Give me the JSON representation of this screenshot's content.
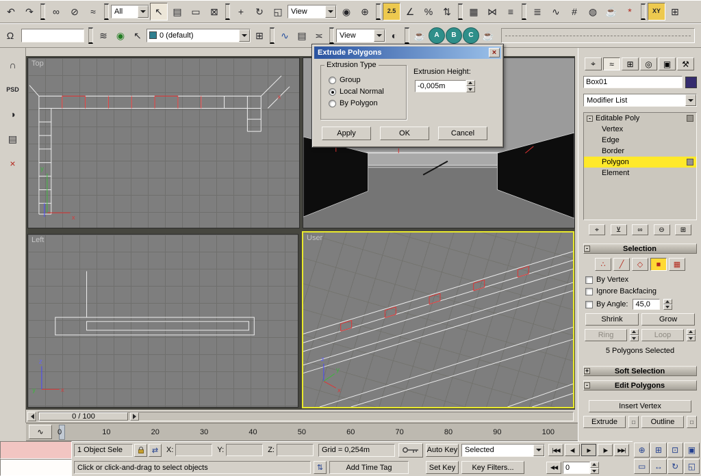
{
  "colors": {
    "object_color": "#352c6e",
    "layer_color": "#2f7f8f",
    "active_viewport_border": "#e9e92c",
    "stack_highlight": "#ffe92a"
  },
  "icons": {
    "close": "×",
    "mini_curve": "∿",
    "stack_collapse": "-",
    "settings_box": "□",
    "abs_offset": "⇄",
    "prompt": "⇅"
  },
  "toolbar1": {
    "selection_filter": "All",
    "ref_coord": "View",
    "group_a": [
      {
        "name": "undo-icon",
        "glyph": "↶"
      },
      {
        "name": "redo-icon",
        "glyph": "↷"
      },
      {
        "sep": true
      },
      {
        "name": "select-and-link-icon",
        "glyph": "∞"
      },
      {
        "name": "unlink-selection-icon",
        "glyph": "⊘"
      },
      {
        "name": "bind-to-space-warp-icon",
        "glyph": "≈"
      },
      {
        "sep": true
      }
    ],
    "group_b": [
      {
        "name": "select-object-icon",
        "glyph": "↖",
        "cls": "pressed"
      },
      {
        "name": "select-by-name-icon",
        "glyph": "▤"
      },
      {
        "name": "rect-selection-region-icon",
        "glyph": "▭"
      },
      {
        "name": "window-crossing-icon",
        "glyph": "⊠"
      },
      {
        "sep": true
      },
      {
        "name": "select-and-move-icon",
        "glyph": "+"
      },
      {
        "name": "select-and-rotate-icon",
        "glyph": "↻"
      },
      {
        "name": "select-and-scale-icon",
        "glyph": "◱"
      }
    ],
    "group_c": [
      {
        "name": "use-pivot-center-icon",
        "glyph": "◉"
      },
      {
        "name": "select-and-manipulate-icon",
        "glyph": "⊕"
      },
      {
        "sep": true
      },
      {
        "name": "snap-toggle-25-icon",
        "glyph": "2.5",
        "cls": "pressed warn small"
      },
      {
        "name": "angle-snap-icon",
        "glyph": "∠"
      },
      {
        "name": "percent-snap-icon",
        "glyph": "%"
      },
      {
        "name": "spinner-snap-icon",
        "glyph": "⇅"
      },
      {
        "sep": true
      },
      {
        "name": "edit-named-selections-icon",
        "glyph": "▦"
      },
      {
        "name": "mirror-icon",
        "glyph": "⋈"
      },
      {
        "name": "align-icon",
        "glyph": "≡"
      },
      {
        "sep": true
      },
      {
        "name": "layer-manager-icon",
        "glyph": "≣"
      },
      {
        "name": "curve-editor-icon",
        "glyph": "∿"
      },
      {
        "name": "schematic-view-icon",
        "glyph": "#"
      },
      {
        "name": "material-editor-icon",
        "glyph": "◍"
      },
      {
        "name": "render-setup-icon",
        "glyph": "☕"
      },
      {
        "name": "render-type-icon",
        "glyph": "*",
        "cls": "red"
      },
      {
        "sep": true
      },
      {
        "name": "axis-constraint-xy-icon",
        "glyph": "XY",
        "cls": "pressed warn small"
      },
      {
        "name": "snap-extra-icon",
        "glyph": "⊞"
      }
    ]
  },
  "toolbar2": {
    "layer": "0 (default)",
    "view": "View",
    "group_a": [
      {
        "name": "named-selection-sets-icon",
        "glyph": "Ω"
      }
    ],
    "group_b": [
      {
        "sep": true
      },
      {
        "name": "layer-list-icon",
        "glyph": "≋"
      },
      {
        "name": "layer-visibility-icon",
        "glyph": "◉",
        "cls": "green"
      },
      {
        "name": "select-objects-in-layer-icon",
        "glyph": "↖"
      }
    ],
    "group_c": [
      {
        "name": "create-new-layer-icon",
        "glyph": "⊞"
      },
      {
        "sep": true
      },
      {
        "name": "open-curve-editor-icon",
        "glyph": "∿",
        "cls": "blue"
      },
      {
        "name": "open-dope-sheet-icon",
        "glyph": "▤"
      },
      {
        "name": "motion-mixer-icon",
        "glyph": "≍"
      },
      {
        "sep": true
      }
    ],
    "group_d": [
      {
        "name": "display-quality-icon",
        "glyph": "◐"
      },
      {
        "sep": true
      },
      {
        "name": "render-scene-icon",
        "glyph": "☕",
        "cls": "teal"
      },
      {
        "name": "render-preset-a-icon",
        "glyph": "A",
        "cls": "round"
      },
      {
        "name": "render-preset-b-icon",
        "glyph": "B",
        "cls": "round"
      },
      {
        "name": "render-preset-c-icon",
        "glyph": "C",
        "cls": "round"
      },
      {
        "name": "quick-render-icon",
        "glyph": "☕",
        "cls": "teal"
      }
    ]
  },
  "left_toolbar": {
    "buttons": [
      {
        "name": "headphones-tool-icon",
        "glyph": "∩"
      },
      {
        "name": "psd-exporter-icon",
        "glyph": "PSD",
        "cls": "small"
      },
      {
        "name": "sphere-tool-icon",
        "glyph": "◑"
      },
      {
        "name": "notes-tool-icon",
        "glyph": "▤"
      },
      {
        "name": "delete-tool-icon",
        "glyph": "×",
        "cls": "red"
      }
    ]
  },
  "viewports": {
    "top_label": "Top",
    "left_label": "Left",
    "user_label": "User",
    "axis": {
      "x": "x",
      "y": "y",
      "z": "z"
    }
  },
  "dialog": {
    "title": "Extrude Polygons",
    "extrusion_type_label": "Extrusion Type",
    "radio_group_label": "Group",
    "radio_local_normal_label": "Local Normal",
    "radio_by_polygon_label": "By Polygon",
    "extrusion_height_label": "Extrusion Height:",
    "extrusion_height_value": "-0,005m",
    "apply_label": "Apply",
    "ok_label": "OK",
    "cancel_label": "Cancel"
  },
  "command_panel": {
    "tabs": [
      {
        "name": "create-tab-icon",
        "glyph": "⌖"
      },
      {
        "name": "modify-tab-icon",
        "glyph": "≈",
        "cls": "active"
      },
      {
        "name": "hierarchy-tab-icon",
        "glyph": "⊞"
      },
      {
        "name": "motion-tab-icon",
        "glyph": "◎"
      },
      {
        "name": "display-tab-icon",
        "glyph": "▣"
      },
      {
        "name": "utilities-tab-icon",
        "glyph": "⚒"
      }
    ],
    "object_name": "Box01",
    "modifier_list_label": "Modifier List",
    "stack_root": "Editable Poly",
    "stack_items": [
      {
        "name": "stack-item-vertex",
        "label": "Vertex"
      },
      {
        "name": "stack-item-edge",
        "label": "Edge"
      },
      {
        "name": "stack-item-border",
        "label": "Border"
      },
      {
        "name": "stack-item-polygon",
        "label": "Polygon",
        "cls": "sel haschip"
      },
      {
        "name": "stack-item-element",
        "label": "Element"
      }
    ],
    "stack_buttons": [
      {
        "name": "pin-stack-icon",
        "glyph": "⌖"
      },
      {
        "name": "show-end-result-icon",
        "glyph": "⊻"
      },
      {
        "name": "make-unique-icon",
        "glyph": "∞"
      },
      {
        "name": "remove-modifier-icon",
        "glyph": "⊖"
      },
      {
        "name": "configure-modifier-sets-icon",
        "glyph": "⊞"
      }
    ],
    "selection_rollout": {
      "sign": "-",
      "label": "Selection"
    },
    "subobject_buttons": [
      {
        "name": "vertex-mode-icon",
        "glyph": "∴"
      },
      {
        "name": "edge-mode-icon",
        "glyph": "╱"
      },
      {
        "name": "border-mode-icon",
        "glyph": "◇"
      },
      {
        "name": "polygon-mode-icon",
        "glyph": "■",
        "cls": "active"
      },
      {
        "name": "element-mode-icon",
        "glyph": "▦"
      }
    ],
    "by_vertex_label": "By Vertex",
    "ignore_backfacing_label": "Ignore Backfacing",
    "by_angle_label": "By Angle:",
    "by_angle_value": "45,0",
    "shrink_label": "Shrink",
    "grow_label": "Grow",
    "ring_label": "Ring",
    "loop_label": "Loop",
    "selection_status": "5 Polygons Selected",
    "soft_selection_rollout": {
      "sign": "+",
      "label": "Soft Selection"
    },
    "edit_polygons_rollout": {
      "sign": "-",
      "label": "Edit Polygons"
    },
    "insert_vertex_label": "Insert Vertex",
    "extrude_label": "Extrude",
    "outline_label": "Outline"
  },
  "timeline": {
    "slider_value": "0 / 100",
    "ticks": [
      "0",
      "10",
      "20",
      "30",
      "40",
      "50",
      "60",
      "70",
      "80",
      "90",
      "100"
    ]
  },
  "status_bar": {
    "selection_status": "1 Object Sele",
    "x_label": "X:",
    "y_label": "Y:",
    "z_label": "Z:",
    "grid_value": "Grid = 0,254m",
    "prompt": "Click or click-and-drag to select objects",
    "add_time_tag": "Add Time Tag",
    "auto_key_label": "Auto Key",
    "set_key_label": "Set Key",
    "key_filters_label": "Key Filters...",
    "selected_filter": "Selected",
    "frame_value": "0",
    "key_mode_glyph": "◀◀",
    "transport": [
      {
        "name": "go-to-start-icon",
        "glyph": "|◀◀"
      },
      {
        "name": "previous-frame-icon",
        "glyph": "◀|"
      },
      {
        "name": "play-animation-icon",
        "glyph": "▶",
        "cls": "framed"
      },
      {
        "name": "next-frame-icon",
        "glyph": "|▶"
      },
      {
        "name": "go-to-end-icon",
        "glyph": "▶▶|"
      }
    ],
    "nav_buttons": [
      {
        "name": "zoom-icon",
        "glyph": "⊕"
      },
      {
        "name": "zoom-all-icon",
        "glyph": "⊞"
      },
      {
        "name": "zoom-extents-icon",
        "glyph": "⊡"
      },
      {
        "name": "zoom-extents-all-icon",
        "glyph": "▣"
      },
      {
        "name": "region-zoom-icon",
        "glyph": "▭"
      },
      {
        "name": "pan-view-icon",
        "glyph": "↔"
      },
      {
        "name": "arc-rotate-icon",
        "glyph": "↻"
      },
      {
        "name": "maximize-viewport-icon",
        "glyph": "◱"
      }
    ]
  }
}
